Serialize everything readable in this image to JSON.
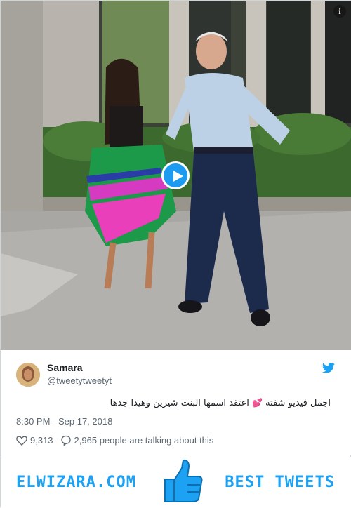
{
  "media": {
    "info_glyph": "i",
    "play_icon": "play-icon"
  },
  "tweet": {
    "author_name": "Samara",
    "author_handle": "@tweetytweetyt",
    "text_before": "اجمل فيديو شفته",
    "text_after": "اعتقد اسمها البنت شيرين وهيدا جدها",
    "timestamp": "8:30 PM - Sep 17, 2018",
    "likes": "9,313",
    "talking": "2,965 people are talking about this",
    "brand_color": "#1da1f2"
  },
  "footer": {
    "left_brand": "ELWIZARA.COM",
    "right_brand": "BEST TWEETS"
  }
}
